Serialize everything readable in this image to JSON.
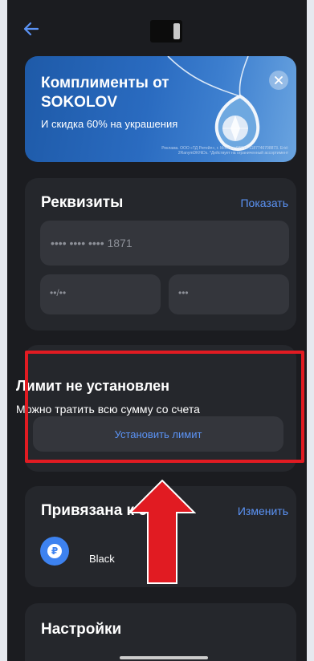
{
  "banner": {
    "title": "Комплименты от SOKOLOV",
    "subtitle": "И скидка 60% на украшения",
    "legal": "Реклама. ООО «ТД Ритейл», г. Москва, ОГРН: 1187746708873. Erid: 2RanymDKHiDs. *Действует на ограниченный ассортимент"
  },
  "requisites": {
    "title": "Реквизиты",
    "show_link": "Показать",
    "card_number": "•••• •••• •••• 1871",
    "expiry": "••/••",
    "cvv": "•••"
  },
  "limit": {
    "title": "Лимит не установлен",
    "subtitle": "Можно тратить всю сумму со счета",
    "button": "Установить лимит"
  },
  "linked": {
    "title": "Привязана к счету",
    "change_link": "Изменить",
    "account_name": "Black",
    "avatar_letter": "₽"
  },
  "settings": {
    "title": "Настройки"
  },
  "colors": {
    "accent": "#5b93f5",
    "highlight": "#e11b22",
    "background": "#1b1c20"
  }
}
